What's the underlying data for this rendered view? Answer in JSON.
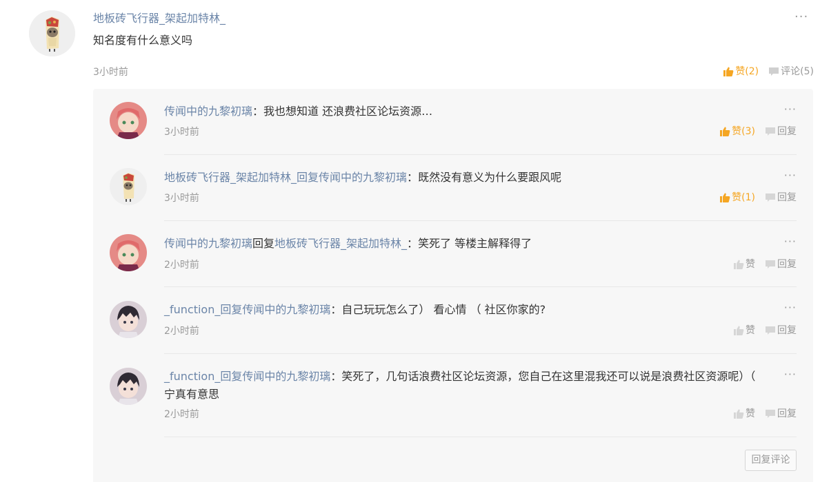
{
  "post": {
    "author": "地板砖飞行器_架起加特林_",
    "text": "知名度有什么意义吗",
    "time": "3小时前",
    "more": "···",
    "like_label": "赞(2)",
    "comment_label": "评论(5)",
    "avatar_icon": "burrito-figure-avatar"
  },
  "replies": [
    {
      "author": "传闻中的九黎初璃",
      "reply_to": "",
      "reply_word": "",
      "colon": "：",
      "text": "我也想知道 还浪费社区论坛资源…",
      "time": "3小时前",
      "like_label": "赞(3)",
      "liked": true,
      "reply_label": "回复",
      "more": "···",
      "avatar": "anime-girl-pink-hair-avatar"
    },
    {
      "author": "地板砖飞行器_架起加特林_",
      "reply_to": "传闻中的九黎初璃",
      "reply_word": "回复",
      "colon": "：",
      "text": "既然没有意义为什么要跟风呢",
      "time": "3小时前",
      "like_label": "赞(1)",
      "liked": true,
      "reply_label": "回复",
      "more": "···",
      "avatar": "burrito-figure-avatar"
    },
    {
      "author": "传闻中的九黎初璃",
      "reply_to": "地板砖飞行器_架起加特林_",
      "reply_word": "回复",
      "colon": "：",
      "text": "笑死了 等楼主解释得了",
      "time": "2小时前",
      "like_label": "赞",
      "liked": false,
      "reply_label": "回复",
      "more": "···",
      "avatar": "anime-girl-pink-hair-avatar"
    },
    {
      "author": "_function_",
      "reply_to": "传闻中的九黎初璃",
      "reply_word": "回复",
      "colon": "：",
      "text": "自己玩玩怎么了） 看心情 （ 社区你家的?",
      "time": "2小时前",
      "like_label": "赞",
      "liked": false,
      "reply_label": "回复",
      "more": "···",
      "avatar": "anime-boy-dark-hair-avatar"
    },
    {
      "author": "_function_",
      "reply_to": "传闻中的九黎初璃",
      "reply_word": "回复",
      "colon": "：",
      "text": "笑死了，几句话浪费社区论坛资源，您自己在这里混我还可以说是浪费社区资源呢）（ 宁真有意思",
      "time": "2小时前",
      "like_label": "赞",
      "liked": false,
      "reply_label": "回复",
      "more": "···",
      "avatar": "anime-boy-dark-hair-avatar"
    }
  ],
  "reply_comment_button": "回复评论",
  "colors": {
    "username": "#6b85a8",
    "liked": "#f5a623",
    "muted": "#999999",
    "panel": "#f7f7f7"
  }
}
